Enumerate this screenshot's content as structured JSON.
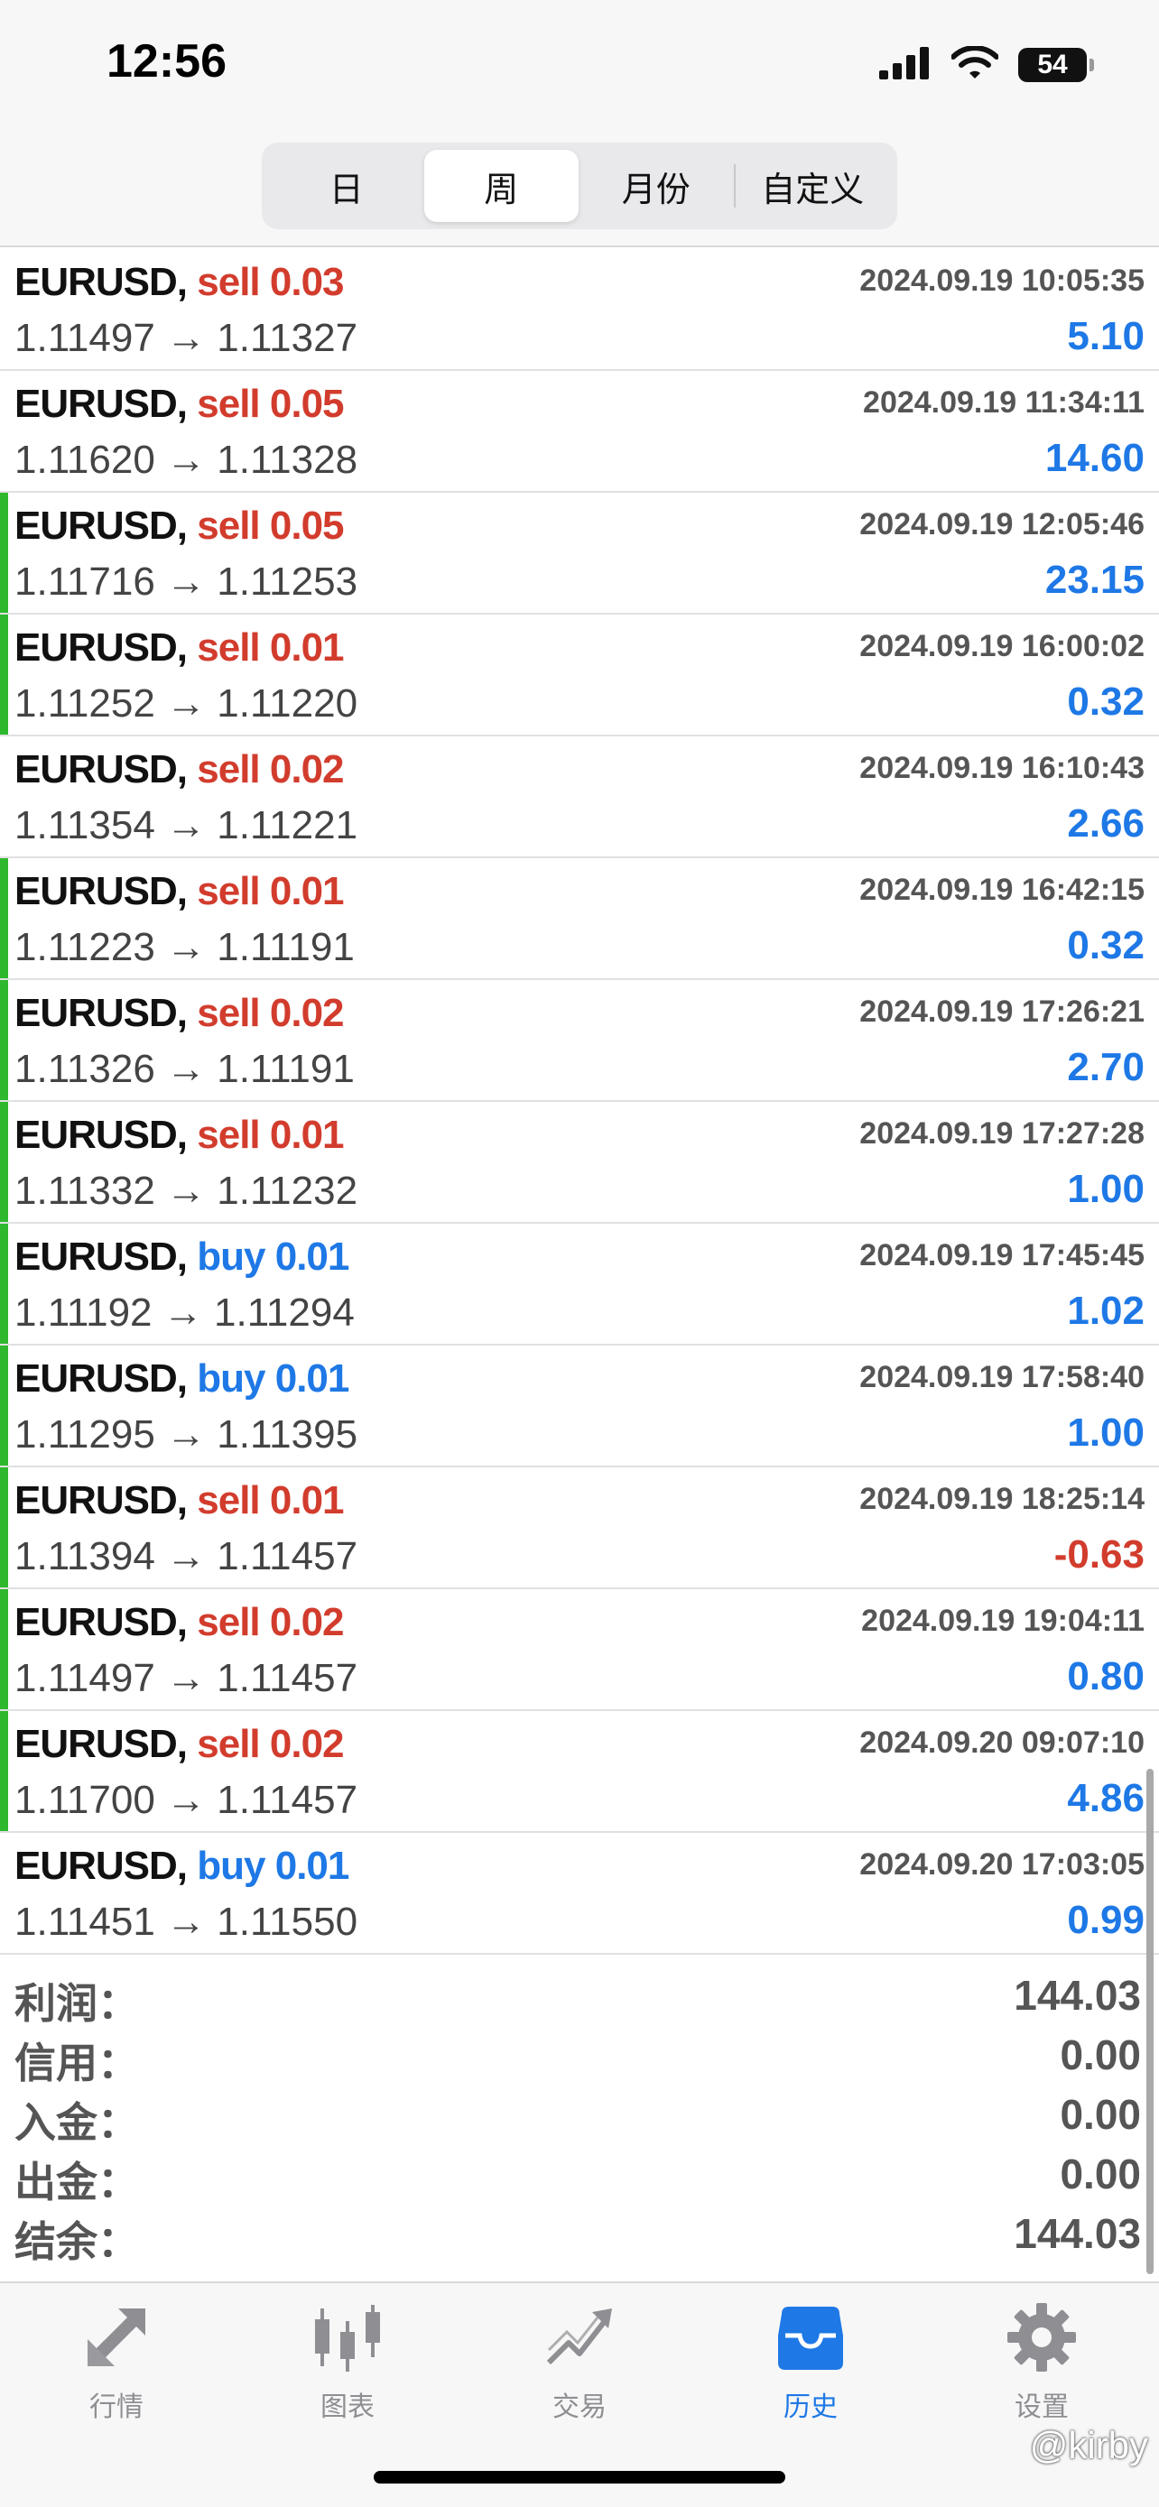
{
  "status_bar": {
    "time": "12:56",
    "battery": "54"
  },
  "segments": [
    {
      "label": "日",
      "active": false
    },
    {
      "label": "周",
      "active": true
    },
    {
      "label": "月份",
      "active": false
    },
    {
      "label": "自定义",
      "active": false
    }
  ],
  "trades": [
    {
      "symbol": "EURUSD,",
      "side": "sell",
      "lots": "0.03",
      "time": "2024.09.19 10:05:35",
      "open": "1.11497",
      "close": "1.11327",
      "profit": "5.10",
      "marked": false
    },
    {
      "symbol": "EURUSD,",
      "side": "sell",
      "lots": "0.05",
      "time": "2024.09.19 11:34:11",
      "open": "1.11620",
      "close": "1.11328",
      "profit": "14.60",
      "marked": false
    },
    {
      "symbol": "EURUSD,",
      "side": "sell",
      "lots": "0.05",
      "time": "2024.09.19 12:05:46",
      "open": "1.11716",
      "close": "1.11253",
      "profit": "23.15",
      "marked": true
    },
    {
      "symbol": "EURUSD,",
      "side": "sell",
      "lots": "0.01",
      "time": "2024.09.19 16:00:02",
      "open": "1.11252",
      "close": "1.11220",
      "profit": "0.32",
      "marked": true
    },
    {
      "symbol": "EURUSD,",
      "side": "sell",
      "lots": "0.02",
      "time": "2024.09.19 16:10:43",
      "open": "1.11354",
      "close": "1.11221",
      "profit": "2.66",
      "marked": false
    },
    {
      "symbol": "EURUSD,",
      "side": "sell",
      "lots": "0.01",
      "time": "2024.09.19 16:42:15",
      "open": "1.11223",
      "close": "1.11191",
      "profit": "0.32",
      "marked": true
    },
    {
      "symbol": "EURUSD,",
      "side": "sell",
      "lots": "0.02",
      "time": "2024.09.19 17:26:21",
      "open": "1.11326",
      "close": "1.11191",
      "profit": "2.70",
      "marked": true
    },
    {
      "symbol": "EURUSD,",
      "side": "sell",
      "lots": "0.01",
      "time": "2024.09.19 17:27:28",
      "open": "1.11332",
      "close": "1.11232",
      "profit": "1.00",
      "marked": true
    },
    {
      "symbol": "EURUSD,",
      "side": "buy",
      "lots": "0.01",
      "time": "2024.09.19 17:45:45",
      "open": "1.11192",
      "close": "1.11294",
      "profit": "1.02",
      "marked": true
    },
    {
      "symbol": "EURUSD,",
      "side": "buy",
      "lots": "0.01",
      "time": "2024.09.19 17:58:40",
      "open": "1.11295",
      "close": "1.11395",
      "profit": "1.00",
      "marked": true
    },
    {
      "symbol": "EURUSD,",
      "side": "sell",
      "lots": "0.01",
      "time": "2024.09.19 18:25:14",
      "open": "1.11394",
      "close": "1.11457",
      "profit": "-0.63",
      "marked": true
    },
    {
      "symbol": "EURUSD,",
      "side": "sell",
      "lots": "0.02",
      "time": "2024.09.19 19:04:11",
      "open": "1.11497",
      "close": "1.11457",
      "profit": "0.80",
      "marked": true
    },
    {
      "symbol": "EURUSD,",
      "side": "sell",
      "lots": "0.02",
      "time": "2024.09.20 09:07:10",
      "open": "1.11700",
      "close": "1.11457",
      "profit": "4.86",
      "marked": true
    },
    {
      "symbol": "EURUSD,",
      "side": "buy",
      "lots": "0.01",
      "time": "2024.09.20 17:03:05",
      "open": "1.11451",
      "close": "1.11550",
      "profit": "0.99",
      "marked": false
    }
  ],
  "arrow": "→",
  "summary": [
    {
      "label": "利润：",
      "value": "144.03"
    },
    {
      "label": "信用：",
      "value": "0.00"
    },
    {
      "label": "入金：",
      "value": "0.00"
    },
    {
      "label": "出金：",
      "value": "0.00"
    },
    {
      "label": "结余：",
      "value": "144.03"
    }
  ],
  "tabs": [
    {
      "label": "行情",
      "icon": "quotes-arrows-icon",
      "active": false
    },
    {
      "label": "图表",
      "icon": "candlestick-chart-icon",
      "active": false
    },
    {
      "label": "交易",
      "icon": "trade-trend-icon",
      "active": false
    },
    {
      "label": "历史",
      "icon": "history-inbox-icon",
      "active": true
    },
    {
      "label": "设置",
      "icon": "gear-icon",
      "active": false
    }
  ],
  "watermark": "@kirby",
  "colors": {
    "sell": "#d23c2d",
    "buy": "#1e78e6",
    "positive": "#1e78e6",
    "negative": "#d23c2d",
    "marker": "#2eb82e",
    "tab_active": "#1e78e6",
    "tab_inactive": "#8e8e93"
  }
}
